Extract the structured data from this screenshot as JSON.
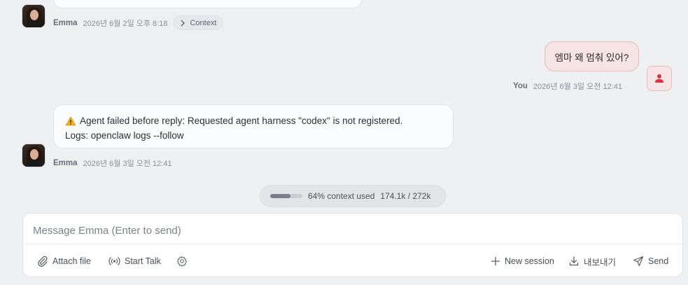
{
  "messages": [
    {
      "sender": "Emma",
      "timestamp": "2026년 6월 2일 오후 8:18",
      "context_chip": "Context"
    },
    {
      "sender": "You",
      "timestamp": "2026년 6월 3일 오전 12:41",
      "text": "엠마 왜 멈춰 있어?"
    },
    {
      "sender": "Emma",
      "timestamp": "2026년 6월 3일 오전 12:41",
      "line1": "Agent failed before reply: Requested agent harness \"codex\" is not registered.",
      "line2": "Logs: openclaw logs --follow"
    }
  ],
  "context_usage": {
    "percent": 64,
    "label": "64% context used",
    "tokens": "174.1k / 272k"
  },
  "composer": {
    "placeholder": "Message Emma (Enter to send)",
    "attach_label": "Attach file",
    "start_talk_label": "Start Talk",
    "new_session_label": "New session",
    "export_label": "내보내기",
    "send_label": "Send"
  },
  "colors": {
    "user_accent": "#e0323c",
    "warning": "#f2b01e"
  },
  "icons": [
    "warning-icon",
    "chevron-right-icon",
    "user-icon",
    "paperclip-icon",
    "broadcast-icon",
    "gear-icon",
    "plus-icon",
    "download-icon",
    "send-icon"
  ]
}
